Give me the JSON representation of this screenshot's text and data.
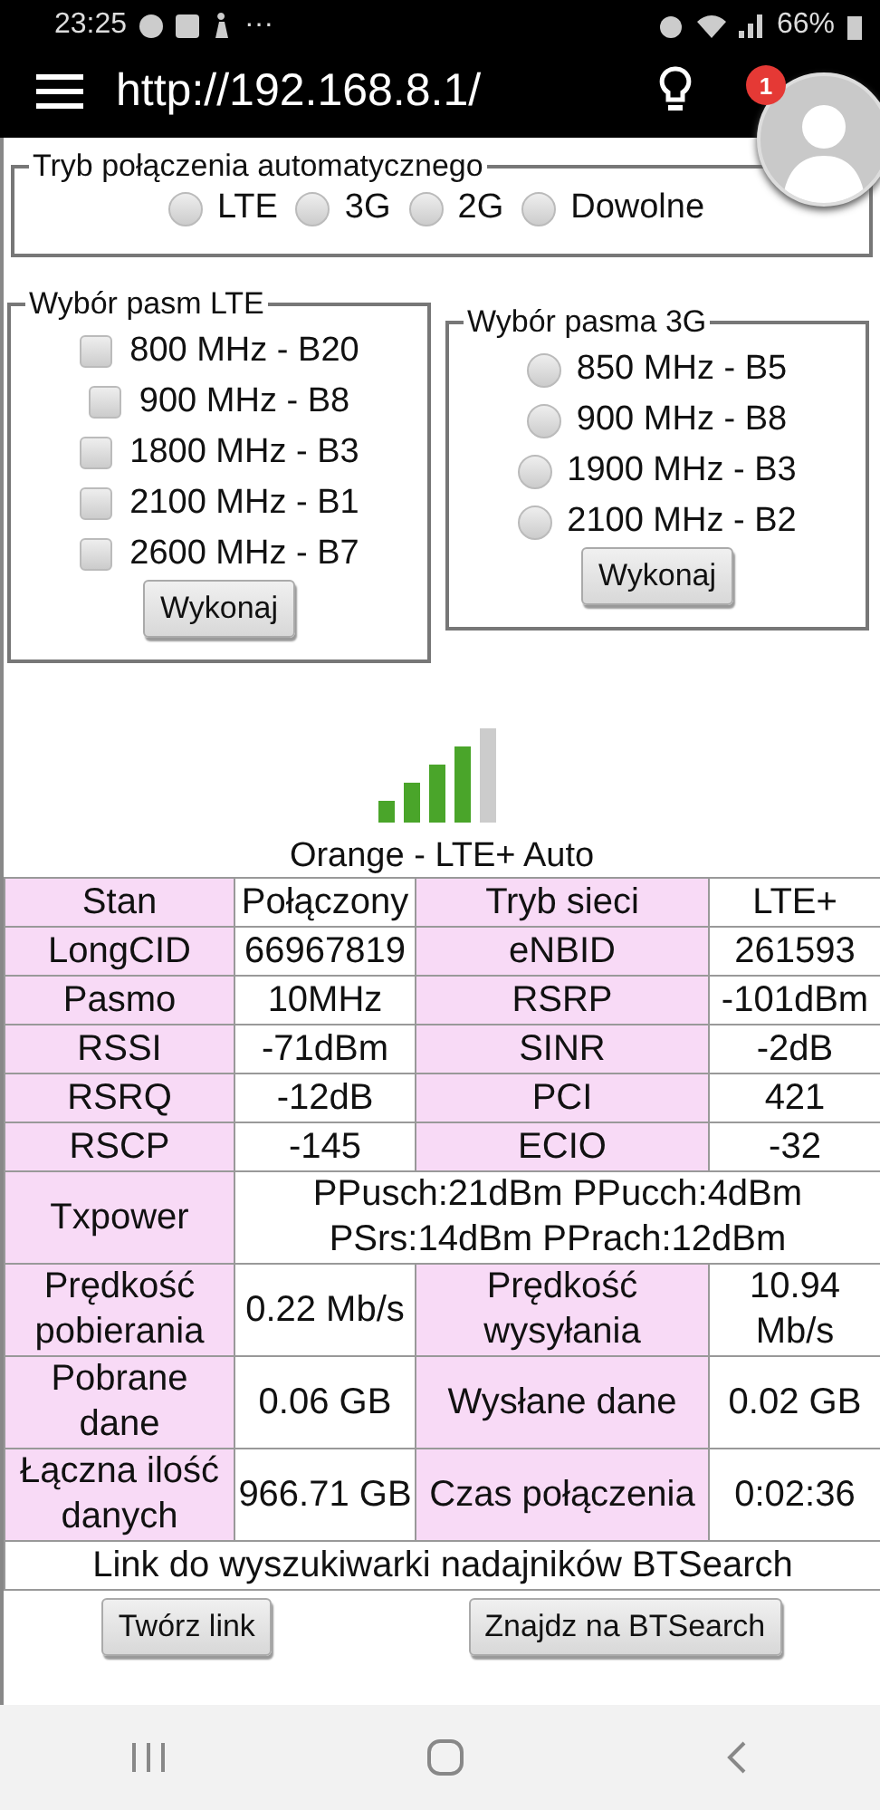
{
  "status_bar": {
    "time": "23:25",
    "ellipsis": "···",
    "battery": "66%"
  },
  "browser": {
    "url": "http://192.168.8.1/",
    "badge": "1"
  },
  "auto_mode": {
    "legend": "Tryb połączenia automatycznego",
    "options": [
      {
        "label": "LTE",
        "selected": false
      },
      {
        "label": "3G",
        "selected": false
      },
      {
        "label": "2G",
        "selected": false
      },
      {
        "label": "Dowolne",
        "selected": false
      }
    ]
  },
  "lte_bands": {
    "legend": "Wybór pasm LTE",
    "options": [
      {
        "label": "800 MHz - B20",
        "checked": false
      },
      {
        "label": "900 MHz - B8",
        "checked": false
      },
      {
        "label": "1800 MHz - B3",
        "checked": false
      },
      {
        "label": "2100 MHz - B1",
        "checked": false
      },
      {
        "label": "2600 MHz - B7",
        "checked": false
      }
    ],
    "button": "Wykonaj"
  },
  "bands_3g": {
    "legend": "Wybór pasma 3G",
    "options": [
      {
        "label": "850 MHz - B5",
        "selected": false
      },
      {
        "label": "900 MHz - B8",
        "selected": false
      },
      {
        "label": "1900 MHz - B3",
        "selected": false
      },
      {
        "label": "2100 MHz - B2",
        "selected": false
      }
    ],
    "button": "Wykonaj"
  },
  "signal": {
    "level": 0.8
  },
  "operator": "Orange - LTE+ Auto",
  "table": {
    "rows": [
      {
        "cells": [
          "Stan",
          "Połączony",
          "Tryb sieci",
          "LTE+"
        ]
      },
      {
        "cells": [
          "LongCID",
          "66967819",
          "eNBID",
          "261593"
        ]
      },
      {
        "cells": [
          "Pasmo",
          "10MHz",
          "RSRP",
          "-101dBm"
        ]
      },
      {
        "cells": [
          "RSSI",
          "-71dBm",
          "SINR",
          "-2dB"
        ]
      },
      {
        "cells": [
          "RSRQ",
          "-12dB",
          "PCI",
          "421"
        ]
      },
      {
        "cells": [
          "RSCP",
          "-145",
          "ECIO",
          "-32"
        ]
      },
      {
        "cells": [
          {
            "text": "Txpower"
          },
          {
            "text": "PPusch:21dBm PPucch:4dBm PSrs:14dBm PPrach:12dBm",
            "colspan": 3
          }
        ]
      },
      {
        "cells": [
          "Prędkość pobierania",
          "0.22 Mb/s",
          "Prędkość wysyłania",
          "10.94 Mb/s"
        ]
      },
      {
        "cells": [
          "Pobrane dane",
          "0.06 GB",
          "Wysłane dane",
          "0.02 GB"
        ]
      },
      {
        "cells": [
          "Łączna ilość danych",
          "966.71 GB",
          "Czas połączenia",
          "0:02:36"
        ]
      }
    ],
    "link_row": "Link do wyszukiwarki nadajników BTSearch"
  },
  "buttons": [
    "Twórz link",
    "Znajdz na BTSearch"
  ]
}
